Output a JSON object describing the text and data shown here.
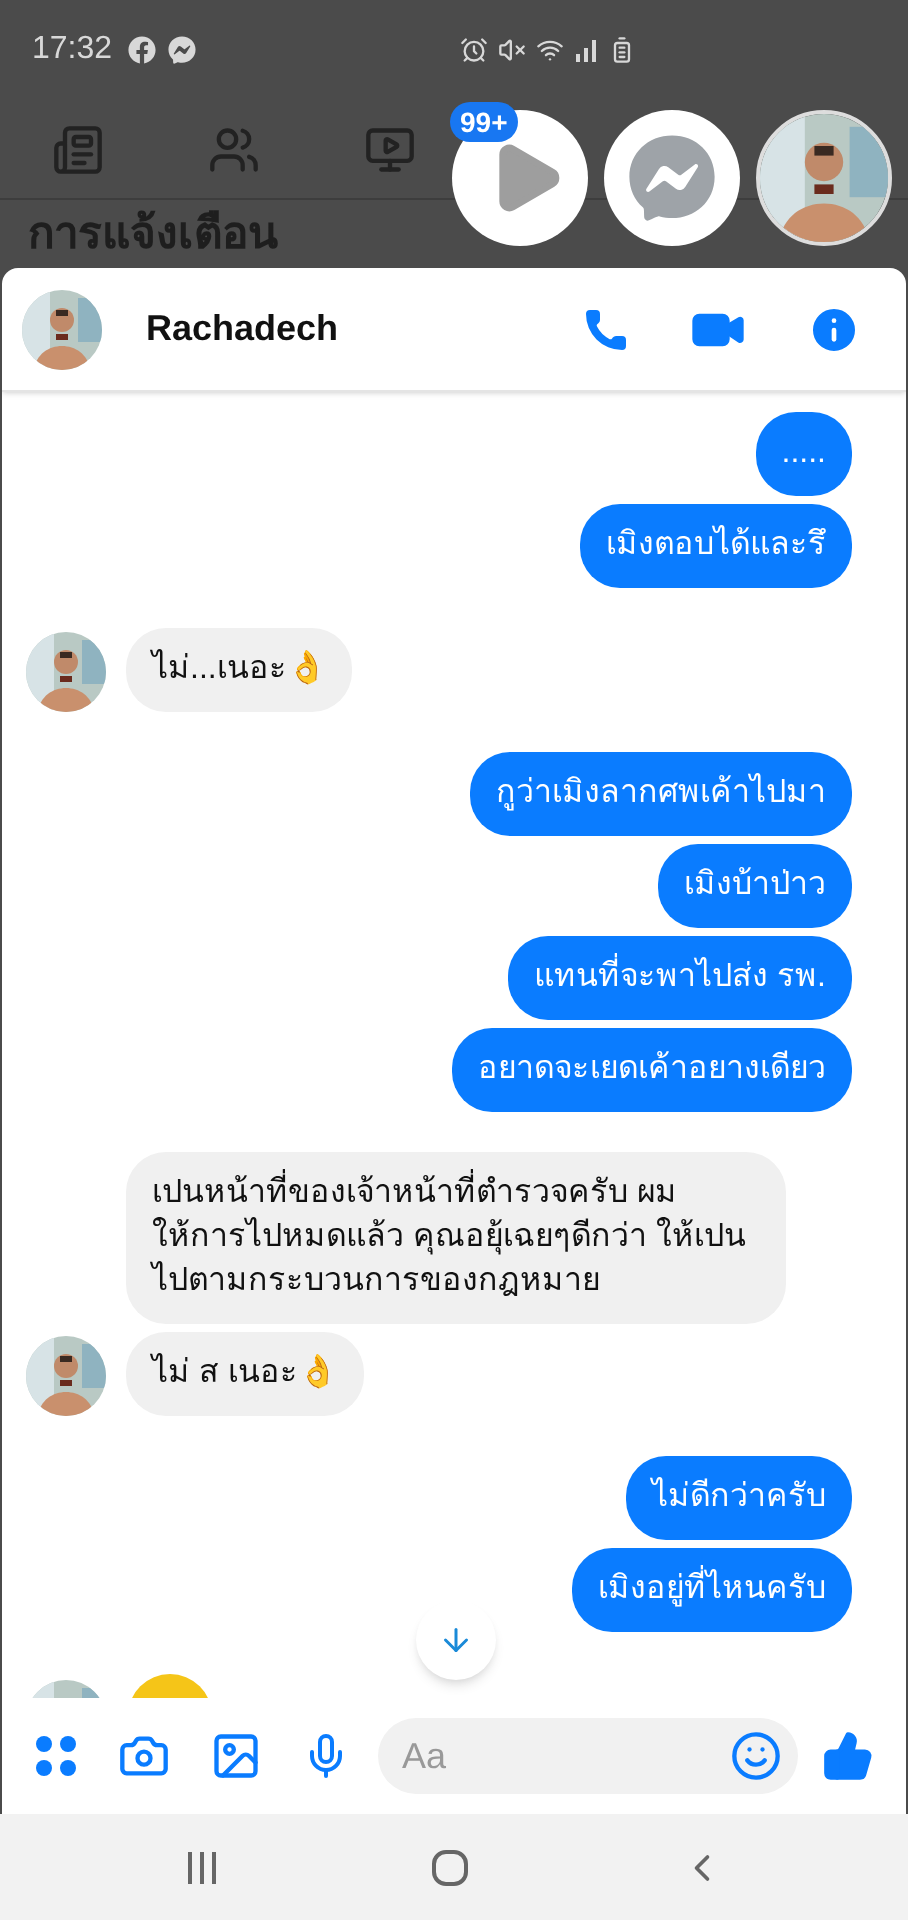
{
  "status_bar": {
    "time": "17:32"
  },
  "background": {
    "heading": "การแจ้งเตือน"
  },
  "chat_heads": [
    {
      "kind": "video",
      "badge": "99+"
    },
    {
      "kind": "messenger"
    },
    {
      "kind": "avatar"
    }
  ],
  "conversation": {
    "name": "Rachadech"
  },
  "messages": [
    {
      "outgoing": true,
      "kind": "text",
      "text": "....."
    },
    {
      "outgoing": true,
      "kind": "text",
      "text": "เมิงตอบได้และรึ"
    },
    {
      "outgoing": false,
      "kind": "text",
      "text": "ไม่...เนอะ👌",
      "show_avatar": true
    },
    {
      "outgoing": true,
      "kind": "text",
      "text": "กูว่าเมิงลากศพเค้าไปมา"
    },
    {
      "outgoing": true,
      "kind": "text",
      "text": "เมิงบ้าป่าว"
    },
    {
      "outgoing": true,
      "kind": "text",
      "text": "แทนที่จะพาไปส่ง รพ."
    },
    {
      "outgoing": true,
      "kind": "text",
      "text": "อยาดจะเยดเค้าอยางเดียว"
    },
    {
      "outgoing": false,
      "kind": "text",
      "text": "เปนหน้าที่ของเจ้าหน้าที่ตำรวจครับ ผม ให้การไปหมดแล้ว คุณอยุ้เฉยๆดีกว่า ให้เปนไปตามกระบวนการของกฎหมาย",
      "show_avatar": false
    },
    {
      "outgoing": false,
      "kind": "text",
      "text": "ไม่ ส เนอะ👌",
      "show_avatar": true
    },
    {
      "outgoing": true,
      "kind": "text",
      "text": "ไม่ดีกว่าครับ"
    },
    {
      "outgoing": true,
      "kind": "text",
      "text": "เมิงอยู่ที่ไหนครับ"
    },
    {
      "outgoing": false,
      "kind": "sticker",
      "show_avatar": true
    }
  ],
  "composer": {
    "placeholder": "Aa"
  }
}
